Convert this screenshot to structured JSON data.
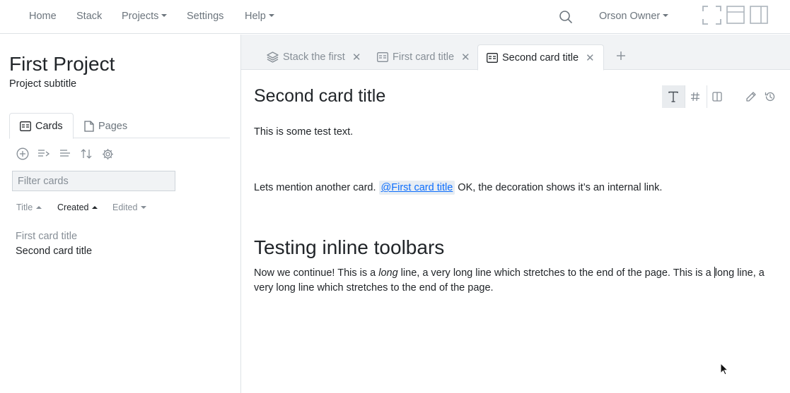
{
  "nav": {
    "home": "Home",
    "stack": "Stack",
    "projects": "Projects",
    "settings": "Settings",
    "help": "Help",
    "user": "Orson Owner"
  },
  "sidebar": {
    "title": "First Project",
    "subtitle": "Project subtitle",
    "tabs": [
      {
        "label": "Cards",
        "icon": "card-icon"
      },
      {
        "label": "Pages",
        "icon": "page-icon"
      }
    ],
    "filter_placeholder": "Filter cards",
    "sort": {
      "title": "Title",
      "created": "Created",
      "edited": "Edited"
    },
    "cards": [
      "First card title",
      "Second card title"
    ]
  },
  "tabs": [
    {
      "label": "Stack the first",
      "icon": "stack-icon"
    },
    {
      "label": "First card title",
      "icon": "card-icon"
    },
    {
      "label": "Second card title",
      "icon": "card-icon",
      "active": true
    }
  ],
  "doc": {
    "title": "Second card title",
    "line1": "This is some test text.",
    "mention_before": "Lets mention another card. ",
    "mention": "@First card title",
    "mention_after": " OK, the decoration shows it’s an internal link.",
    "heading": "Testing inline toolbars",
    "para_a": "Now we continue! This is a ",
    "para_italic": "long",
    "para_b": " line, a very long line which stretches to the end of the page. This is a ",
    "para_c": "long line, a very long line which stretches to the end of the page."
  },
  "colors": {
    "link": "#0d6efd",
    "muted": "#6c757d",
    "border": "#dee2e6",
    "tabbar_bg": "#f1f3f5"
  }
}
